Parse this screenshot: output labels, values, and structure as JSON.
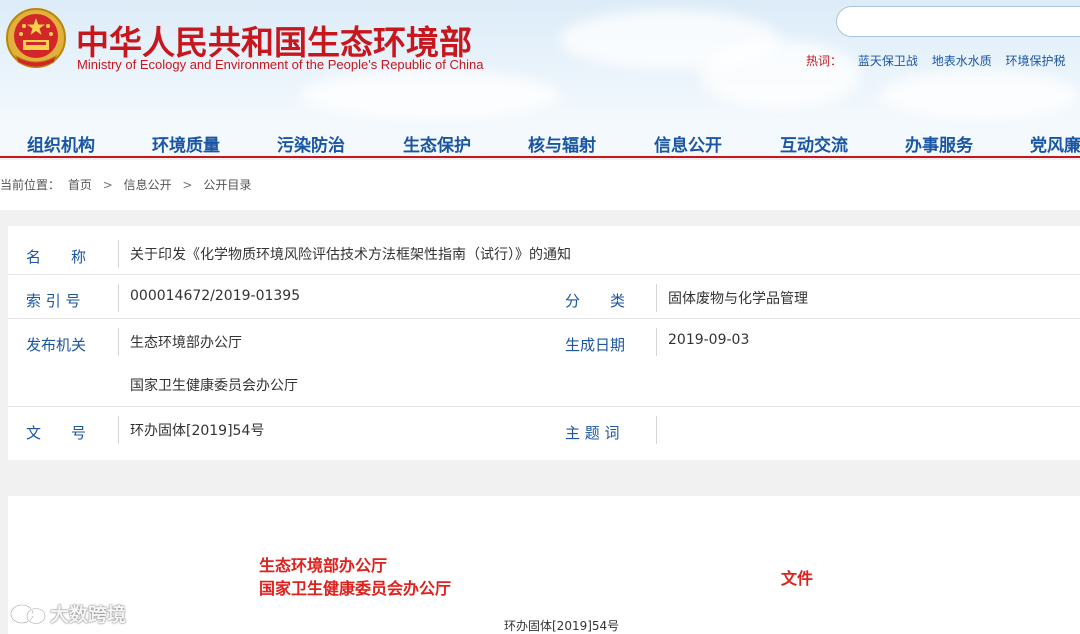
{
  "header": {
    "title_cn": "中华人民共和国生态环境部",
    "title_en": "Ministry of Ecology and Environment of the People's Republic of China",
    "search_placeholder": "",
    "hot_label": "热词：",
    "hot_links": [
      "蓝天保卫战",
      "地表水水质",
      "环境保护税"
    ]
  },
  "nav": {
    "items": [
      "组织机构",
      "环境质量",
      "污染防治",
      "生态保护",
      "核与辐射",
      "信息公开",
      "互动交流",
      "办事服务",
      "党风廉"
    ]
  },
  "breadcrumb": {
    "prefix": "当前位置：",
    "items": [
      "首页",
      "信息公开",
      "公开目录"
    ],
    "separator": ">"
  },
  "info": {
    "name_label": "名　　称",
    "name_value": "关于印发《化学物质环境风险评估技术方法框架性指南（试行）》的通知",
    "index_label": "索 引 号",
    "index_value": "000014672/2019-01395",
    "category_label": "分　　类",
    "category_value": "固体废物与化学品管理",
    "issuer_label": "发布机关",
    "issuer_value_1": "生态环境部办公厅",
    "issuer_value_2": "国家卫生健康委员会办公厅",
    "date_label": "生成日期",
    "date_value": "2019-09-03",
    "docno_label": "文　　号",
    "docno_value": "环办固体[2019]54号",
    "keywords_label": "主 题 词",
    "keywords_value": ""
  },
  "doc": {
    "issuer_1": "生态环境部办公厅",
    "issuer_2": "国家卫生健康委员会办公厅",
    "word": "文件",
    "number": "环办固体[2019]54号"
  },
  "watermark": {
    "text": "大数跨境"
  },
  "colors": {
    "brand_red": "#c8161d",
    "link_blue": "#1a56a4",
    "doc_red": "#e0201c"
  }
}
